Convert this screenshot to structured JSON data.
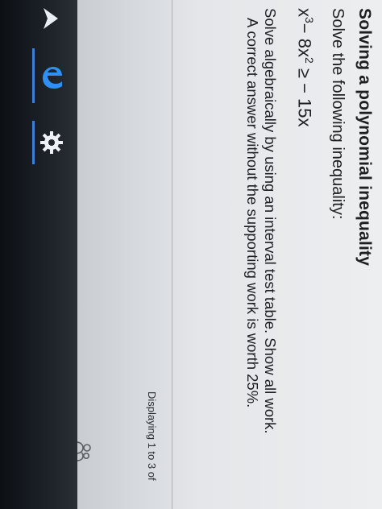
{
  "question": {
    "title": "Solving a polynomial inequality",
    "prompt": "Solve the following inequality:",
    "expression": {
      "x": "x",
      "exp1": "3",
      "mid": "− 8x",
      "exp2": "2",
      "rhs": " ≥ − 15x"
    },
    "instructions_line1": "Solve algebraically by using an interval test table.  Show all work.",
    "instructions_line2": "A correct answer without the supporting work is worth 25%."
  },
  "footer": {
    "displaying": "Displaying 1 to 3 of"
  },
  "taskbar": {
    "icons": [
      "back-arrow-icon",
      "edge-browser-icon",
      "settings-gear-icon"
    ],
    "accent_color": "#3d7fd6"
  }
}
